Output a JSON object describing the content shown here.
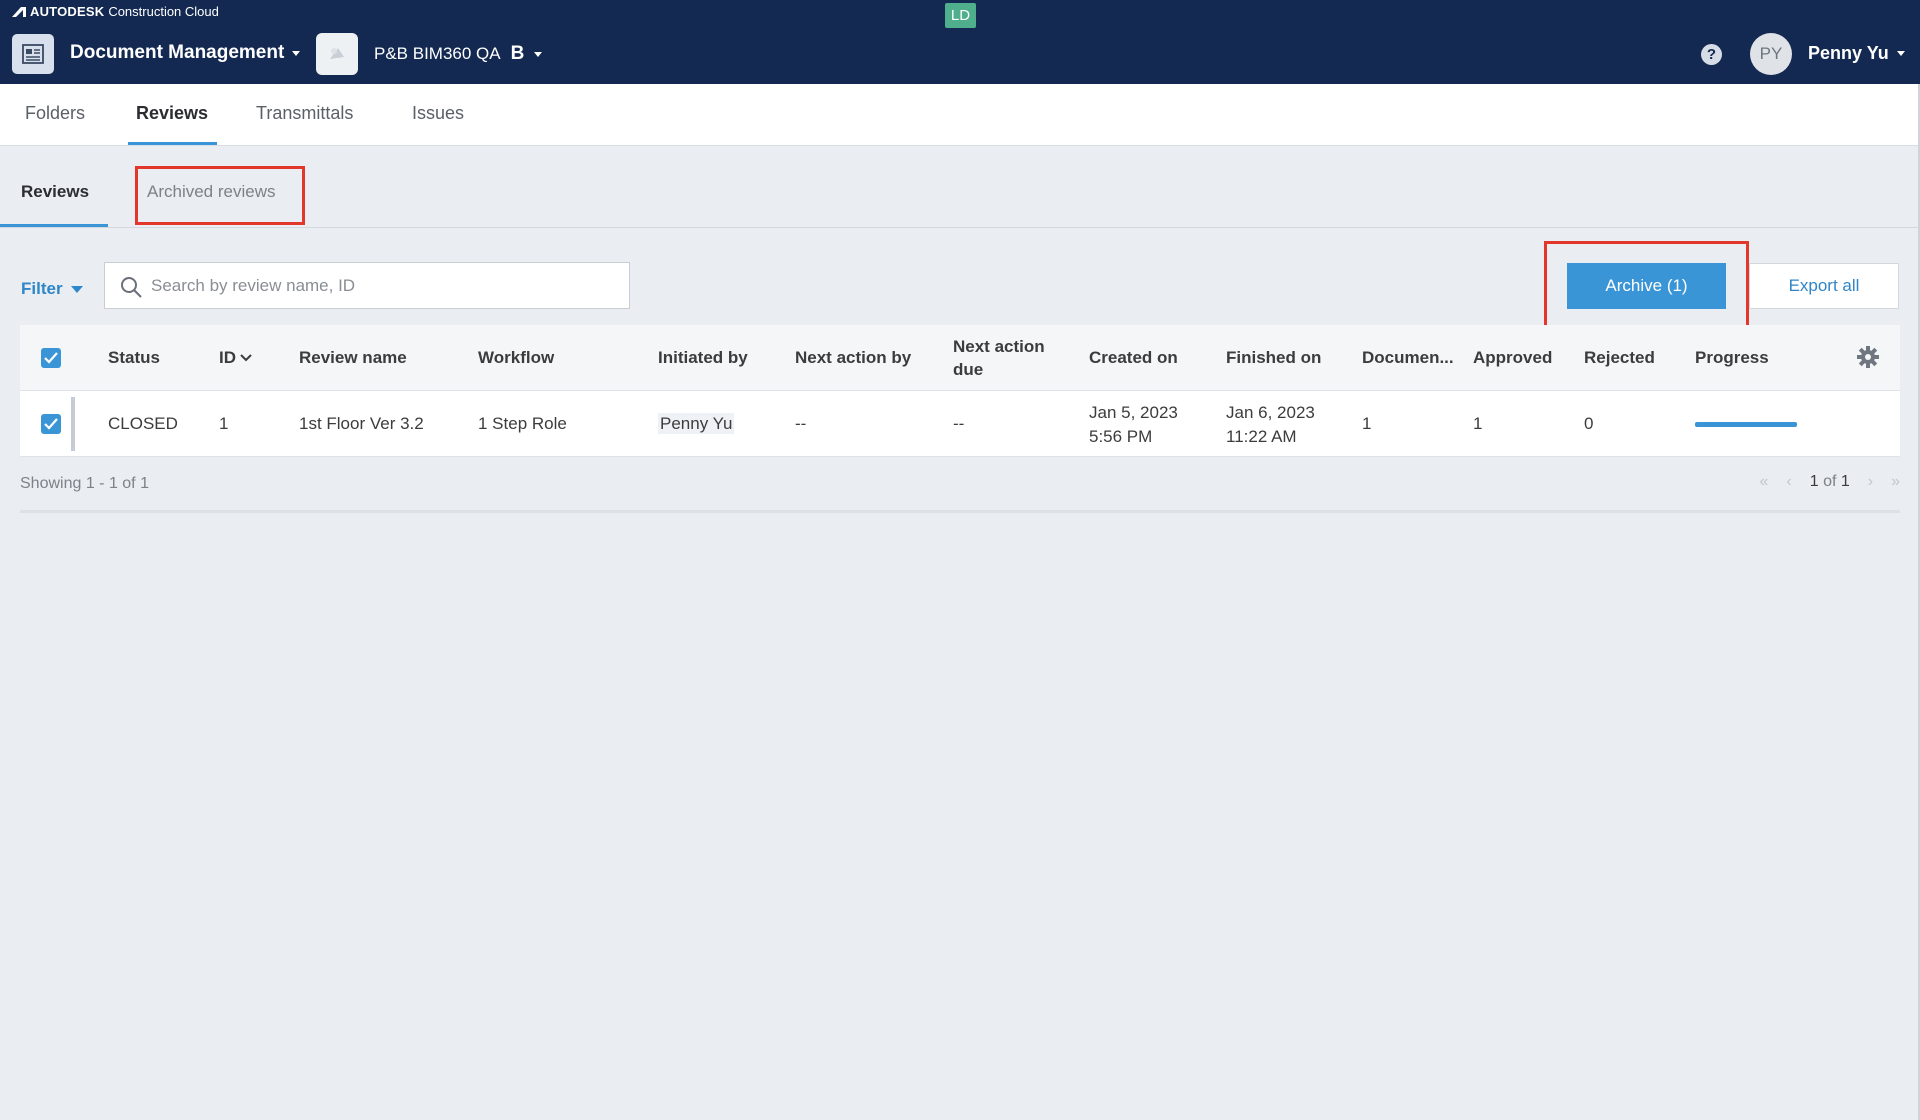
{
  "header": {
    "brand_name": "AUTODESK",
    "brand_product": "Construction Cloud",
    "badge": "LD",
    "app_name": "Document Management",
    "project_name": "P&B BIM360 QA",
    "project_badge": "B",
    "user_initials": "PY",
    "user_name": "Penny Yu",
    "help_icon": "?"
  },
  "tabs": [
    {
      "label": "Folders"
    },
    {
      "label": "Reviews"
    },
    {
      "label": "Transmittals"
    },
    {
      "label": "Issues"
    }
  ],
  "active_tab": "Reviews",
  "subtabs": [
    {
      "label": "Reviews"
    },
    {
      "label": "Archived reviews"
    }
  ],
  "toolbar": {
    "filter_label": "Filter",
    "search_placeholder": "Search by review name, ID",
    "archive_label": "Archive (1)",
    "export_label": "Export all"
  },
  "table": {
    "columns": [
      "Status",
      "ID",
      "Review name",
      "Workflow",
      "Initiated by",
      "Next action by",
      "Next action due",
      "Created on",
      "Finished on",
      "Documen...",
      "Approved",
      "Rejected",
      "Progress"
    ],
    "rows": [
      {
        "selected": true,
        "status": "CLOSED",
        "id": "1",
        "review_name": "1st Floor Ver 3.2",
        "workflow": "1 Step Role",
        "initiated_by": "Penny Yu",
        "next_action_by": "--",
        "next_action_due": "--",
        "created_date": "Jan 5, 2023",
        "created_time": "5:56 PM",
        "finished_date": "Jan 6, 2023",
        "finished_time": "11:22 AM",
        "documents": "1",
        "approved": "1",
        "rejected": "0",
        "progress": 1.0
      }
    ]
  },
  "footer": {
    "showing": "Showing 1 - 1 of 1",
    "page_current": "1",
    "page_of": "of",
    "page_total": "1"
  },
  "colors": {
    "header_bg": "#132951",
    "accent": "#3a95d6",
    "highlight": "#e2372a",
    "badge": "#4fae8b"
  }
}
